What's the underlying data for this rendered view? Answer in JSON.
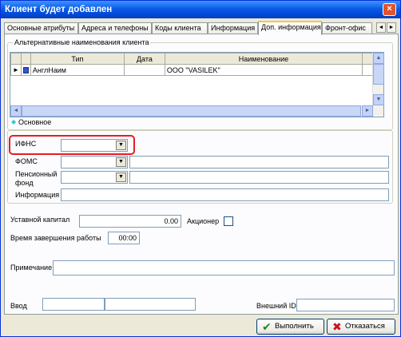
{
  "window": {
    "title": "Клиент будет добавлен",
    "close_glyph": "×"
  },
  "tabs": [
    {
      "label": "Основные атрибуты"
    },
    {
      "label": "Адреса и телефоны"
    },
    {
      "label": "Коды клиента"
    },
    {
      "label": "Информация"
    },
    {
      "label": "Доп. информация"
    },
    {
      "label": "Фронт-офис"
    }
  ],
  "tab_scroll": {
    "left": "◄",
    "right": "►"
  },
  "alt_names": {
    "group_label": "Альтернативные наименования клиента",
    "columns": [
      "Тип",
      "Дата",
      "Наименование"
    ],
    "rows": [
      {
        "marker": "►",
        "type": "АнглНаим",
        "date": "",
        "name": "ООО \"VASILEK\""
      }
    ],
    "legend": "Основное",
    "legend_marker": "◆",
    "scroll": {
      "up": "▲",
      "down": "▼",
      "left": "◄",
      "right": "►"
    }
  },
  "fields": {
    "ifns_label": "ИФНС",
    "foms_label": "ФОМС",
    "pension_label_1": "Пенсионный",
    "pension_label_2": "фонд",
    "info_label": "Информация",
    "combo_arrow": "▼",
    "capital_label": "Уставной капитал",
    "capital_value": "0.00",
    "shareholder_label": "Акционер",
    "end_time_label": "Время завершения работы",
    "end_time_value": "00:00",
    "note_label": "Примечание",
    "input_label": "Ввод",
    "external_id_label": "Внешний ID"
  },
  "buttons": {
    "ok_label": "Выполнить",
    "ok_icon": "✔",
    "cancel_label": "Отказаться",
    "cancel_icon": "✖"
  },
  "colors": {
    "ok_icon": "#1E8C1E",
    "cancel_icon": "#C8141E",
    "highlight": "#E31E24",
    "legend_marker": "#33CCDD"
  }
}
